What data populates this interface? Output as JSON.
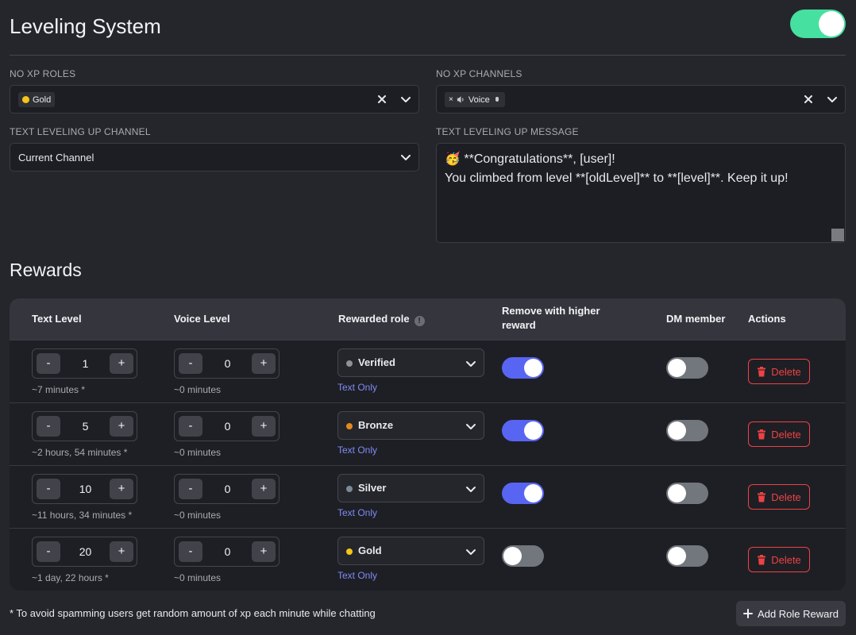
{
  "header": {
    "title": "Leveling System",
    "enabled": true
  },
  "no_xp_roles": {
    "label": "NO XP ROLES",
    "chips": [
      {
        "name": "Gold",
        "color": "#f5c518"
      }
    ]
  },
  "no_xp_channels": {
    "label": "NO XP CHANNELS",
    "chips": [
      {
        "remove": "×",
        "name": "Voice"
      }
    ]
  },
  "text_channel": {
    "label": "TEXT LEVELING UP CHANNEL",
    "value": "Current Channel"
  },
  "text_message": {
    "label": "TEXT LEVELING UP MESSAGE",
    "emoji": "🥳",
    "line1": " **Congratulations**, [user]!",
    "line2": "You climbed from level **[oldLevel]** to **[level]**. Keep it up!"
  },
  "rewards": {
    "title": "Rewards",
    "columns": {
      "text_level": "Text Level",
      "voice_level": "Voice Level",
      "rewarded_role": "Rewarded role",
      "remove_higher": "Remove with higher reward",
      "dm_member": "DM member",
      "actions": "Actions"
    },
    "minus": "-",
    "plus": "+",
    "text_only": "Text Only",
    "delete_label": "Delete",
    "rows": [
      {
        "text_level": "1",
        "text_time": "~7 minutes *",
        "voice_level": "0",
        "voice_time": "~0 minutes",
        "role": "Verified",
        "role_color": "#8e9297",
        "remove_higher": true,
        "dm_member": false
      },
      {
        "text_level": "5",
        "text_time": "~2 hours, 54 minutes *",
        "voice_level": "0",
        "voice_time": "~0 minutes",
        "role": "Bronze",
        "role_color": "#e08a1e",
        "remove_higher": true,
        "dm_member": false
      },
      {
        "text_level": "10",
        "text_time": "~11 hours, 34 minutes *",
        "voice_level": "0",
        "voice_time": "~0 minutes",
        "role": "Silver",
        "role_color": "#7a8a99",
        "remove_higher": true,
        "dm_member": false
      },
      {
        "text_level": "20",
        "text_time": "~1 day, 22 hours *",
        "voice_level": "0",
        "voice_time": "~0 minutes",
        "role": "Gold",
        "role_color": "#f5c518",
        "remove_higher": false,
        "dm_member": false
      }
    ]
  },
  "footer": {
    "note": "* To avoid spamming users get random amount of xp each minute while chatting",
    "add_button": "Add Role Reward"
  },
  "colors": {
    "accent": "#5865f2",
    "master_toggle": "#46e0a0",
    "danger": "#ed4245",
    "link": "#7f8bf6"
  }
}
